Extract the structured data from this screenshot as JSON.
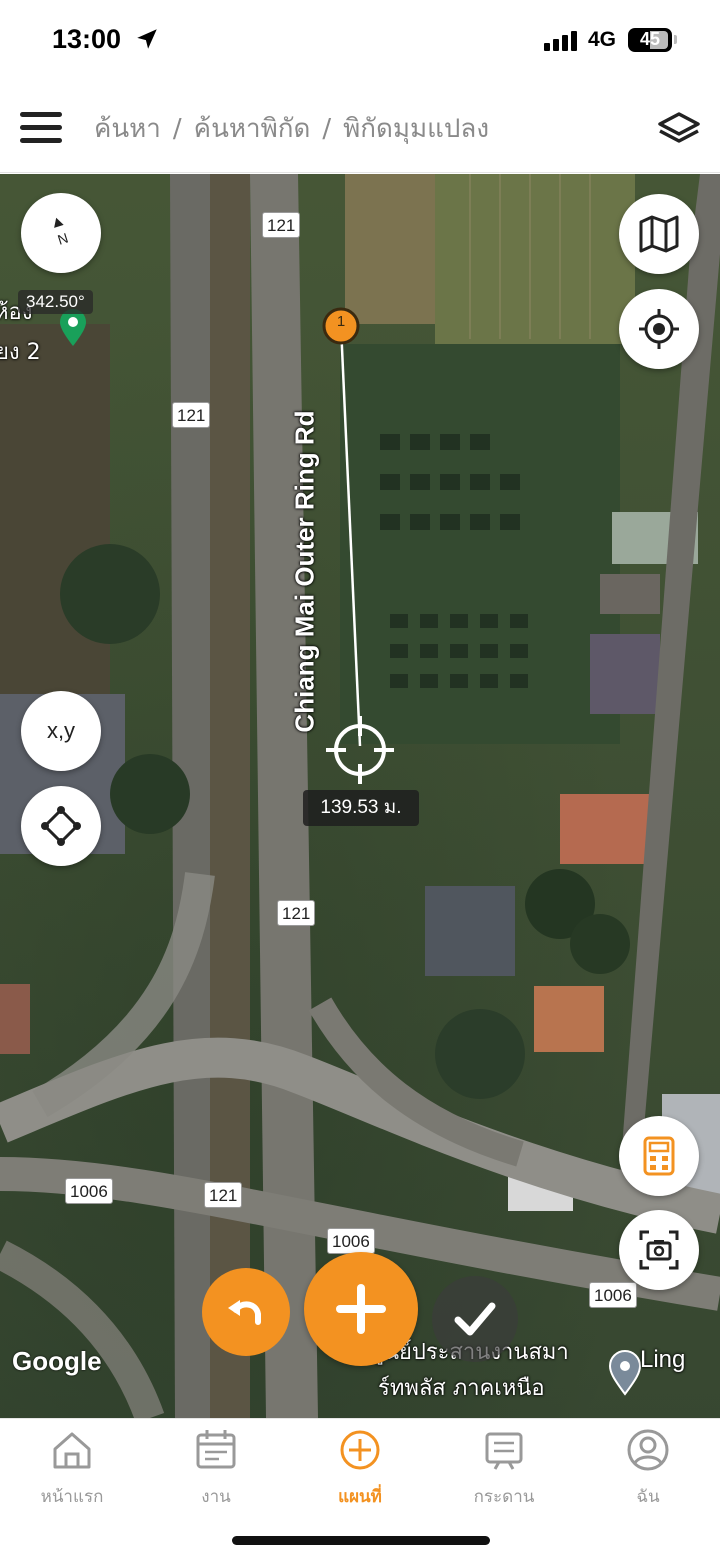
{
  "status_bar": {
    "time": "13:00",
    "network": "4G",
    "battery": "45"
  },
  "header": {
    "breadcrumb": [
      "ค้นหา",
      "ค้นหาพิกัด",
      "พิกัดมุมแปลง"
    ],
    "separator": "/"
  },
  "map": {
    "compass_heading": "342.50°",
    "compass_letter": "N",
    "coordinate_button_label": "x,y",
    "point_marker_label": "1",
    "distance_label": "139.53 ม.",
    "road_name": "Chiang Mai Outer Ring Rd",
    "route_shields": [
      "121",
      "121",
      "121",
      "121",
      "1006",
      "1006",
      "1006"
    ],
    "place_labels": {
      "left_partial_1": "ห้อง",
      "left_partial_2": "ยง 2",
      "poi_line1": "ศูนย์ประสานงานสมา",
      "poi_line2": "ร์ทพลัส ภาคเหนือ",
      "poi_right": "Ling"
    },
    "attribution": "Google",
    "icons": [
      "compass-icon",
      "map-view-icon",
      "my-location-icon",
      "vertex-icon",
      "calculator-icon",
      "screenshot-icon",
      "undo-icon",
      "add-icon",
      "confirm-check-icon"
    ]
  },
  "tabbar": {
    "items": [
      {
        "label": "หน้าแรก",
        "icon": "home-icon",
        "active": false
      },
      {
        "label": "งาน",
        "icon": "calendar-icon",
        "active": false
      },
      {
        "label": "แผนที่",
        "icon": "map-add-icon",
        "active": true
      },
      {
        "label": "กระดาน",
        "icon": "board-icon",
        "active": false
      },
      {
        "label": "ฉัน",
        "icon": "profile-icon",
        "active": false
      }
    ]
  },
  "colors": {
    "accent": "#f39221",
    "inactive_tab": "#999999",
    "breadcrumb": "#8a8a8a"
  }
}
